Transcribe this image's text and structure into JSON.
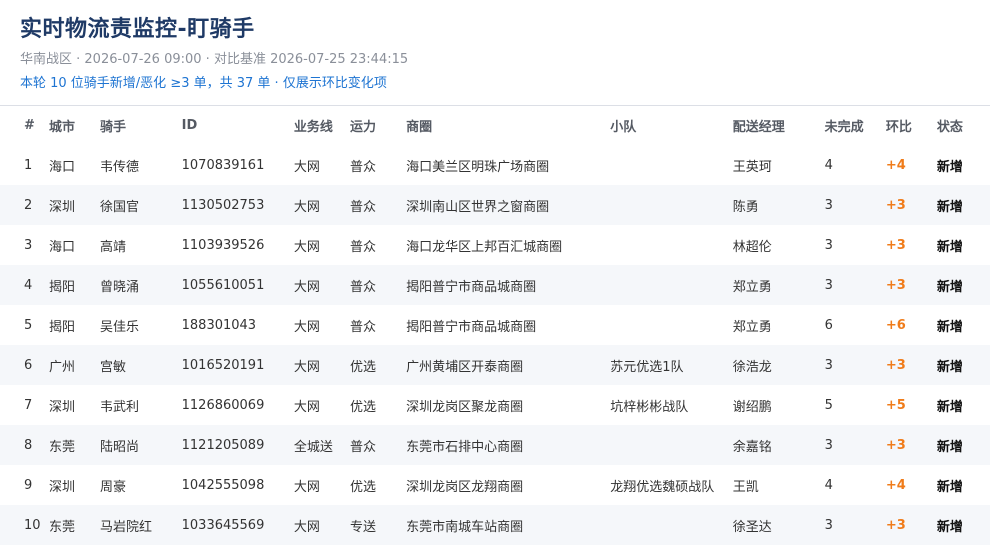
{
  "header": {
    "title": "实时物流责监控-盯骑手",
    "subtitle": "华南战区 · 2026-07-26 09:00 · 对比基准 2026-07-25 23:44:15",
    "summary": "本轮 10 位骑手新增/恶化 ≥3 单，共 37 单 · 仅展示环比变化项"
  },
  "table": {
    "columns": [
      "#",
      "城市",
      "骑手",
      "ID",
      "业务线",
      "运力",
      "商圈",
      "小队",
      "配送经理",
      "未完成",
      "环比",
      "状态"
    ],
    "rows": [
      {
        "no": "1",
        "city": "海口",
        "rider": "韦传德",
        "id": "1070839161",
        "line": "大网",
        "capacity": "普众",
        "area": "海口美兰区明珠广场商圈",
        "team": "",
        "manager": "王英珂",
        "pending": "4",
        "delta": "+4",
        "status": "新增"
      },
      {
        "no": "2",
        "city": "深圳",
        "rider": "徐国官",
        "id": "1130502753",
        "line": "大网",
        "capacity": "普众",
        "area": "深圳南山区世界之窗商圈",
        "team": "",
        "manager": "陈勇",
        "pending": "3",
        "delta": "+3",
        "status": "新增"
      },
      {
        "no": "3",
        "city": "海口",
        "rider": "高靖",
        "id": "1103939526",
        "line": "大网",
        "capacity": "普众",
        "area": "海口龙华区上邦百汇城商圈",
        "team": "",
        "manager": "林超伦",
        "pending": "3",
        "delta": "+3",
        "status": "新增"
      },
      {
        "no": "4",
        "city": "揭阳",
        "rider": "曾晓涌",
        "id": "1055610051",
        "line": "大网",
        "capacity": "普众",
        "area": "揭阳普宁市商品城商圈",
        "team": "",
        "manager": "郑立勇",
        "pending": "3",
        "delta": "+3",
        "status": "新增"
      },
      {
        "no": "5",
        "city": "揭阳",
        "rider": "吴佳乐",
        "id": "188301043",
        "line": "大网",
        "capacity": "普众",
        "area": "揭阳普宁市商品城商圈",
        "team": "",
        "manager": "郑立勇",
        "pending": "6",
        "delta": "+6",
        "status": "新增"
      },
      {
        "no": "6",
        "city": "广州",
        "rider": "宫敏",
        "id": "1016520191",
        "line": "大网",
        "capacity": "优选",
        "area": "广州黄埔区开泰商圈",
        "team": "苏元优选1队",
        "manager": "徐浩龙",
        "pending": "3",
        "delta": "+3",
        "status": "新增"
      },
      {
        "no": "7",
        "city": "深圳",
        "rider": "韦武利",
        "id": "1126860069",
        "line": "大网",
        "capacity": "优选",
        "area": "深圳龙岗区聚龙商圈",
        "team": "坑梓彬彬战队",
        "manager": "谢绍鹏",
        "pending": "5",
        "delta": "+5",
        "status": "新增"
      },
      {
        "no": "8",
        "city": "东莞",
        "rider": "陆昭尚",
        "id": "1121205089",
        "line": "全城送",
        "capacity": "普众",
        "area": "东莞市石排中心商圈",
        "team": "",
        "manager": "余嘉铭",
        "pending": "3",
        "delta": "+3",
        "status": "新增"
      },
      {
        "no": "9",
        "city": "深圳",
        "rider": "周豪",
        "id": "1042555098",
        "line": "大网",
        "capacity": "优选",
        "area": "深圳龙岗区龙翔商圈",
        "team": "龙翔优选魏硕战队",
        "manager": "王凯",
        "pending": "4",
        "delta": "+4",
        "status": "新增"
      },
      {
        "no": "10",
        "city": "东莞",
        "rider": "马岩院红",
        "id": "1033645569",
        "line": "大网",
        "capacity": "专送",
        "area": "东莞市南城车站商圈",
        "team": "",
        "manager": "徐圣达",
        "pending": "3",
        "delta": "+3",
        "status": "新增"
      }
    ]
  },
  "colors": {
    "title": "#1f3a66",
    "summary": "#1e74d2",
    "delta": "#f07c1a",
    "stripe": "#f5f7fa"
  }
}
